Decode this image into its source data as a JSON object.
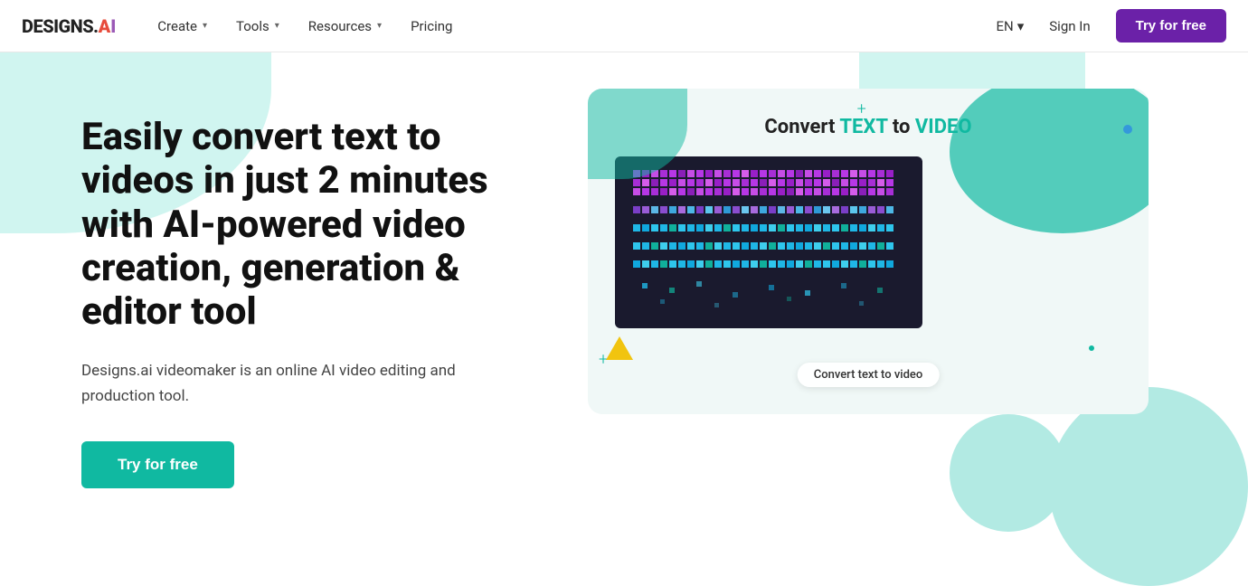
{
  "nav": {
    "logo_text": "DESIGNS.",
    "logo_ai_letters": "AI",
    "items": [
      {
        "label": "Create",
        "has_chevron": true
      },
      {
        "label": "Tools",
        "has_chevron": true
      },
      {
        "label": "Resources",
        "has_chevron": true
      },
      {
        "label": "Pricing",
        "has_chevron": false
      }
    ],
    "lang": "EN",
    "sign_in": "Sign In",
    "try_free": "Try for free"
  },
  "hero": {
    "heading": "Easily convert text to videos in just 2 minutes with AI-powered video creation, generation & editor tool",
    "subtext": "Designs.ai videomaker is an online AI video editing and production tool.",
    "cta_label": "Try for free"
  },
  "illustration": {
    "convert_title_prefix": "Convert ",
    "convert_text": "TEXT",
    "convert_mid": " to ",
    "convert_video": "VIDEO",
    "convert_label": "Convert text to video"
  },
  "colors": {
    "teal": "#10b9a1",
    "purple": "#6b21a8",
    "nav_bg": "#ffffff"
  }
}
